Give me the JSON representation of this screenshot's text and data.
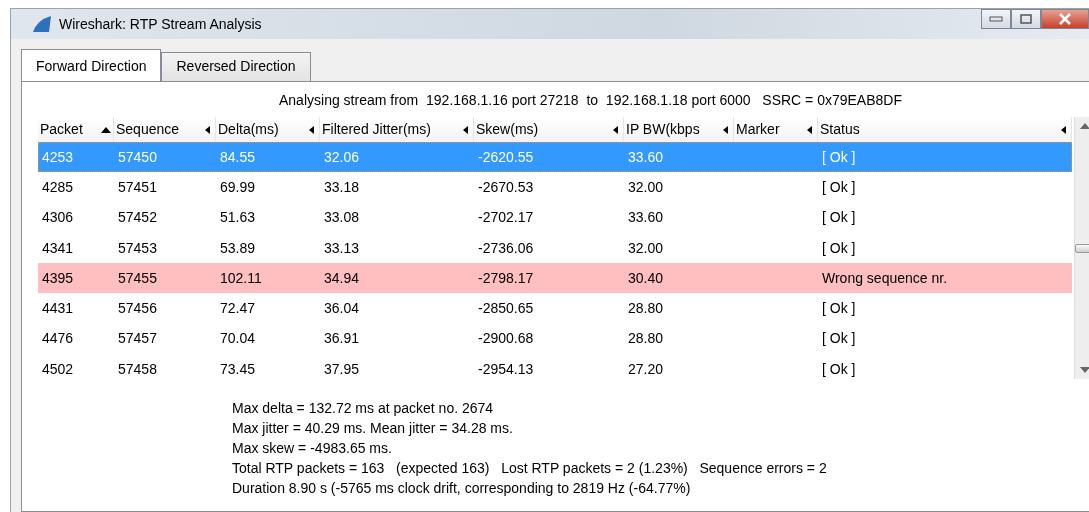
{
  "window": {
    "title": "Wireshark: RTP Stream Analysis"
  },
  "tabs": [
    {
      "label": "Forward Direction",
      "selected": true
    },
    {
      "label": "Reversed Direction",
      "selected": false
    }
  ],
  "stream_info": "Analysing stream from  192.168.1.16 port 27218  to  192.168.1.18 port 6000   SSRC = 0x79EAB8DF",
  "table": {
    "columns": [
      {
        "label": "Packet",
        "sorted": true
      },
      {
        "label": "Sequence",
        "sorted": false
      },
      {
        "label": "Delta(ms)",
        "sorted": false
      },
      {
        "label": "Filtered Jitter(ms)",
        "sorted": false
      },
      {
        "label": "Skew(ms)",
        "sorted": false
      },
      {
        "label": "IP BW(kbps",
        "sorted": false
      },
      {
        "label": "Marker",
        "sorted": false
      },
      {
        "label": "Status",
        "sorted": false
      }
    ],
    "rows": [
      {
        "cells": [
          "4253",
          "57450",
          "84.55",
          "32.06",
          "-2620.55",
          "33.60",
          "",
          "[ Ok ]"
        ],
        "selected": true,
        "error": false
      },
      {
        "cells": [
          "4285",
          "57451",
          "69.99",
          "33.18",
          "-2670.53",
          "32.00",
          "",
          "[ Ok ]"
        ],
        "selected": false,
        "error": false
      },
      {
        "cells": [
          "4306",
          "57452",
          "51.63",
          "33.08",
          "-2702.17",
          "33.60",
          "",
          "[ Ok ]"
        ],
        "selected": false,
        "error": false
      },
      {
        "cells": [
          "4341",
          "57453",
          "53.89",
          "33.13",
          "-2736.06",
          "32.00",
          "",
          "[ Ok ]"
        ],
        "selected": false,
        "error": false
      },
      {
        "cells": [
          "4395",
          "57455",
          "102.11",
          "34.94",
          "-2798.17",
          "30.40",
          "",
          "Wrong sequence nr."
        ],
        "selected": false,
        "error": true
      },
      {
        "cells": [
          "4431",
          "57456",
          "72.47",
          "36.04",
          "-2850.65",
          "28.80",
          "",
          "[ Ok ]"
        ],
        "selected": false,
        "error": false
      },
      {
        "cells": [
          "4476",
          "57457",
          "70.04",
          "36.91",
          "-2900.68",
          "28.80",
          "",
          "[ Ok ]"
        ],
        "selected": false,
        "error": false
      },
      {
        "cells": [
          "4502",
          "57458",
          "73.45",
          "37.95",
          "-2954.13",
          "27.20",
          "",
          "[ Ok ]"
        ],
        "selected": false,
        "error": false
      }
    ]
  },
  "summary": [
    "Max delta = 132.72 ms at packet no. 2674",
    "Max jitter = 40.29 ms. Mean jitter = 34.28 ms.",
    "Max skew = -4983.65 ms.",
    "Total RTP packets = 163   (expected 163)   Lost RTP packets = 2 (1.23%)   Sequence errors = 2",
    "Duration 8.90 s (-5765 ms clock drift, corresponding to 2819 Hz (-64.77%)"
  ]
}
